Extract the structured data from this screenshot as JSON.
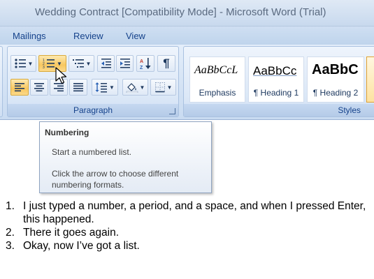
{
  "window": {
    "title": "Wedding Contract [Compatibility Mode] - Microsoft Word (Trial)"
  },
  "tabs": [
    {
      "label": "Mailings"
    },
    {
      "label": "Review"
    },
    {
      "label": "View"
    }
  ],
  "ribbon": {
    "paragraph_group_label": "Paragraph",
    "styles_group_label": "Styles",
    "styles": [
      {
        "sample": "AaBbCcL",
        "name": "Emphasis"
      },
      {
        "sample": "AaBbCc",
        "name": "¶ Heading 1"
      },
      {
        "sample": "AaBbC",
        "name": "¶ Heading 2"
      }
    ]
  },
  "tooltip": {
    "title": "Numbering",
    "line1": "Start a numbered list.",
    "line2": "Click the arrow to choose different",
    "line3": "numbering formats."
  },
  "document": {
    "items": [
      {
        "num": "1.",
        "text": "I just typed a number, a period, and a space, and when I pressed Enter, this happened."
      },
      {
        "num": "2.",
        "text": "There it goes again."
      },
      {
        "num": "3.",
        "text": "Okay, now I’ve got a list."
      }
    ]
  }
}
